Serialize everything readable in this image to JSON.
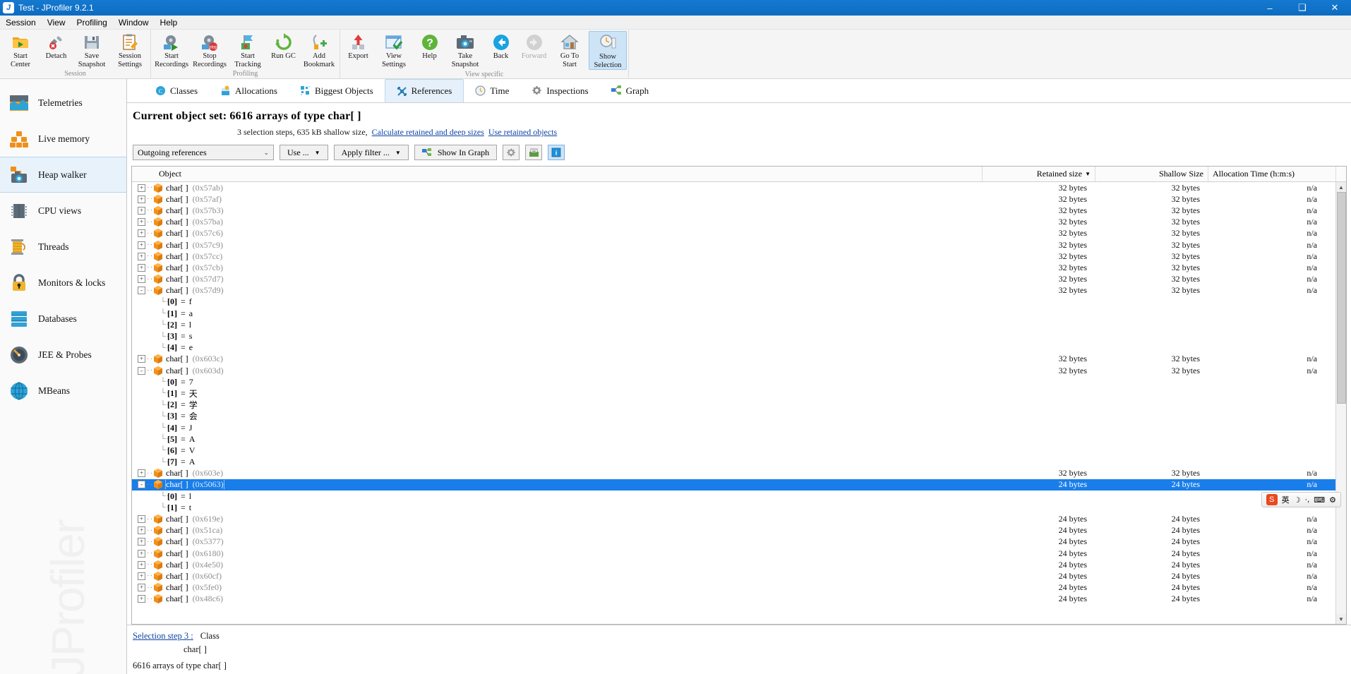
{
  "window": {
    "title": "Test - JProfiler 9.2.1",
    "app_icon": "jprofiler-icon",
    "minimize": "–",
    "maximize": "❑",
    "close": "✕"
  },
  "menubar": [
    {
      "label": "Session"
    },
    {
      "label": "View"
    },
    {
      "label": "Profiling"
    },
    {
      "label": "Window"
    },
    {
      "label": "Help"
    }
  ],
  "toolbar": {
    "groups": [
      {
        "label": "Session",
        "buttons": [
          {
            "caption": "Start\nCenter",
            "icon": "start-center-icon",
            "state": "normal"
          },
          {
            "caption": "Detach",
            "icon": "detach-icon",
            "state": "normal"
          },
          {
            "caption": "Save\nSnapshot",
            "icon": "save-snapshot-icon",
            "state": "normal"
          },
          {
            "caption": "Session\nSettings",
            "icon": "session-settings-icon",
            "state": "normal"
          }
        ]
      },
      {
        "label": "Profiling",
        "buttons": [
          {
            "caption": "Start\nRecordings",
            "icon": "start-recordings-icon",
            "state": "normal"
          },
          {
            "caption": "Stop\nRecordings",
            "icon": "stop-recordings-icon",
            "state": "normal"
          },
          {
            "caption": "Start\nTracking",
            "icon": "start-tracking-icon",
            "state": "normal"
          },
          {
            "caption": "Run GC",
            "icon": "run-gc-icon",
            "state": "normal"
          },
          {
            "caption": "Add\nBookmark",
            "icon": "add-bookmark-icon",
            "state": "normal"
          }
        ]
      },
      {
        "label": "View specific",
        "buttons": [
          {
            "caption": "Export",
            "icon": "export-icon",
            "state": "normal"
          },
          {
            "caption": "View\nSettings",
            "icon": "view-settings-icon",
            "state": "normal"
          },
          {
            "caption": "Help",
            "icon": "help-icon",
            "state": "normal"
          },
          {
            "caption": "Take\nSnapshot",
            "icon": "take-snapshot-icon",
            "state": "normal"
          },
          {
            "caption": "Back",
            "icon": "back-arrow-icon",
            "state": "normal"
          },
          {
            "caption": "Forward",
            "icon": "forward-arrow-icon",
            "state": "disabled"
          },
          {
            "caption": "Go To\nStart",
            "icon": "go-to-start-icon",
            "state": "normal"
          },
          {
            "caption": "Show\nSelection",
            "icon": "show-selection-icon",
            "state": "active"
          }
        ]
      }
    ]
  },
  "sidebar": {
    "items": [
      {
        "label": "Telemetries",
        "icon": "telemetries-icon",
        "active": false
      },
      {
        "label": "Live memory",
        "icon": "live-memory-icon",
        "active": false
      },
      {
        "label": "Heap walker",
        "icon": "heap-walker-icon",
        "active": true
      },
      {
        "label": "CPU views",
        "icon": "cpu-views-icon",
        "active": false
      },
      {
        "label": "Threads",
        "icon": "threads-icon",
        "active": false
      },
      {
        "label": "Monitors & locks",
        "icon": "monitors-locks-icon",
        "active": false
      },
      {
        "label": "Databases",
        "icon": "databases-icon",
        "active": false
      },
      {
        "label": "JEE & Probes",
        "icon": "jee-probes-icon",
        "active": false
      },
      {
        "label": "MBeans",
        "icon": "mbeans-icon",
        "active": false
      }
    ],
    "watermark": "JProfiler"
  },
  "tabs": [
    {
      "label": "Classes",
      "icon": "classes-icon",
      "active": false
    },
    {
      "label": "Allocations",
      "icon": "allocations-icon",
      "active": false
    },
    {
      "label": "Biggest Objects",
      "icon": "biggest-objects-icon",
      "active": false
    },
    {
      "label": "References",
      "icon": "references-icon",
      "active": true
    },
    {
      "label": "Time",
      "icon": "time-icon",
      "active": false
    },
    {
      "label": "Inspections",
      "icon": "inspections-icon",
      "active": false
    },
    {
      "label": "Graph",
      "icon": "graph-icon",
      "active": false
    }
  ],
  "headline": {
    "title": "Current object set: 6616 arrays of type char[ ]",
    "summary": "3 selection steps, 635 kB shallow size,",
    "link_calculate": "Calculate retained and deep sizes",
    "link_retained": "Use retained objects"
  },
  "filterbar": {
    "mode_value": "Outgoing references",
    "mode_arrow": "⌄",
    "use_label": "Use ...",
    "apply_filter_label": "Apply filter ...",
    "dropdown_arrow": "▼",
    "show_in_graph_label": "Show In Graph",
    "gear_icon": "gear-icon",
    "snapshot_icon": "export-view-icon",
    "info_icon": "info-icon"
  },
  "table": {
    "columns": [
      {
        "label": "Object",
        "sorted": false
      },
      {
        "label": "Retained size",
        "sorted": true,
        "sort_arrow": "▼"
      },
      {
        "label": "Shallow Size",
        "sorted": false
      },
      {
        "label": "Allocation Time (h:m:s)",
        "sorted": false
      }
    ],
    "rows": [
      {
        "kind": "obj",
        "toggle": "+",
        "name": "char[ ]",
        "addr": "(0x57ab)",
        "retained": "32 bytes",
        "shallow": "32 bytes",
        "alloc": "n/a",
        "selected": false
      },
      {
        "kind": "obj",
        "toggle": "+",
        "name": "char[ ]",
        "addr": "(0x57af)",
        "retained": "32 bytes",
        "shallow": "32 bytes",
        "alloc": "n/a",
        "selected": false
      },
      {
        "kind": "obj",
        "toggle": "+",
        "name": "char[ ]",
        "addr": "(0x57b3)",
        "retained": "32 bytes",
        "shallow": "32 bytes",
        "alloc": "n/a",
        "selected": false
      },
      {
        "kind": "obj",
        "toggle": "+",
        "name": "char[ ]",
        "addr": "(0x57ba)",
        "retained": "32 bytes",
        "shallow": "32 bytes",
        "alloc": "n/a",
        "selected": false
      },
      {
        "kind": "obj",
        "toggle": "+",
        "name": "char[ ]",
        "addr": "(0x57c6)",
        "retained": "32 bytes",
        "shallow": "32 bytes",
        "alloc": "n/a",
        "selected": false
      },
      {
        "kind": "obj",
        "toggle": "+",
        "name": "char[ ]",
        "addr": "(0x57c9)",
        "retained": "32 bytes",
        "shallow": "32 bytes",
        "alloc": "n/a",
        "selected": false
      },
      {
        "kind": "obj",
        "toggle": "+",
        "name": "char[ ]",
        "addr": "(0x57cc)",
        "retained": "32 bytes",
        "shallow": "32 bytes",
        "alloc": "n/a",
        "selected": false
      },
      {
        "kind": "obj",
        "toggle": "+",
        "name": "char[ ]",
        "addr": "(0x57cb)",
        "retained": "32 bytes",
        "shallow": "32 bytes",
        "alloc": "n/a",
        "selected": false
      },
      {
        "kind": "obj",
        "toggle": "+",
        "name": "char[ ]",
        "addr": "(0x57d7)",
        "retained": "32 bytes",
        "shallow": "32 bytes",
        "alloc": "n/a",
        "selected": false
      },
      {
        "kind": "obj",
        "toggle": "-",
        "name": "char[ ]",
        "addr": "(0x57d9)",
        "retained": "32 bytes",
        "shallow": "32 bytes",
        "alloc": "n/a",
        "selected": false
      },
      {
        "kind": "elem",
        "index": "[0]",
        "value": "f"
      },
      {
        "kind": "elem",
        "index": "[1]",
        "value": "a"
      },
      {
        "kind": "elem",
        "index": "[2]",
        "value": "l"
      },
      {
        "kind": "elem",
        "index": "[3]",
        "value": "s"
      },
      {
        "kind": "elem",
        "index": "[4]",
        "value": "e"
      },
      {
        "kind": "obj",
        "toggle": "+",
        "name": "char[ ]",
        "addr": "(0x603c)",
        "retained": "32 bytes",
        "shallow": "32 bytes",
        "alloc": "n/a",
        "selected": false
      },
      {
        "kind": "obj",
        "toggle": "-",
        "name": "char[ ]",
        "addr": "(0x603d)",
        "retained": "32 bytes",
        "shallow": "32 bytes",
        "alloc": "n/a",
        "selected": false
      },
      {
        "kind": "elem",
        "index": "[0]",
        "value": "7"
      },
      {
        "kind": "elem",
        "index": "[1]",
        "value": "天"
      },
      {
        "kind": "elem",
        "index": "[2]",
        "value": "学"
      },
      {
        "kind": "elem",
        "index": "[3]",
        "value": "会"
      },
      {
        "kind": "elem",
        "index": "[4]",
        "value": "J"
      },
      {
        "kind": "elem",
        "index": "[5]",
        "value": "A"
      },
      {
        "kind": "elem",
        "index": "[6]",
        "value": "V"
      },
      {
        "kind": "elem",
        "index": "[7]",
        "value": "A"
      },
      {
        "kind": "obj",
        "toggle": "+",
        "name": "char[ ]",
        "addr": "(0x603e)",
        "retained": "32 bytes",
        "shallow": "32 bytes",
        "alloc": "n/a",
        "selected": false
      },
      {
        "kind": "obj",
        "toggle": "-",
        "name": "char[ ]",
        "addr": "(0x5063)",
        "retained": "24 bytes",
        "shallow": "24 bytes",
        "alloc": "n/a",
        "selected": true
      },
      {
        "kind": "elem",
        "index": "[0]",
        "value": "l"
      },
      {
        "kind": "elem",
        "index": "[1]",
        "value": "t"
      },
      {
        "kind": "obj",
        "toggle": "+",
        "name": "char[ ]",
        "addr": "(0x619e)",
        "retained": "24 bytes",
        "shallow": "24 bytes",
        "alloc": "n/a",
        "selected": false
      },
      {
        "kind": "obj",
        "toggle": "+",
        "name": "char[ ]",
        "addr": "(0x51ca)",
        "retained": "24 bytes",
        "shallow": "24 bytes",
        "alloc": "n/a",
        "selected": false
      },
      {
        "kind": "obj",
        "toggle": "+",
        "name": "char[ ]",
        "addr": "(0x5377)",
        "retained": "24 bytes",
        "shallow": "24 bytes",
        "alloc": "n/a",
        "selected": false
      },
      {
        "kind": "obj",
        "toggle": "+",
        "name": "char[ ]",
        "addr": "(0x6180)",
        "retained": "24 bytes",
        "shallow": "24 bytes",
        "alloc": "n/a",
        "selected": false
      },
      {
        "kind": "obj",
        "toggle": "+",
        "name": "char[ ]",
        "addr": "(0x4e50)",
        "retained": "24 bytes",
        "shallow": "24 bytes",
        "alloc": "n/a",
        "selected": false
      },
      {
        "kind": "obj",
        "toggle": "+",
        "name": "char[ ]",
        "addr": "(0x60cf)",
        "retained": "24 bytes",
        "shallow": "24 bytes",
        "alloc": "n/a",
        "selected": false
      },
      {
        "kind": "obj",
        "toggle": "+",
        "name": "char[ ]",
        "addr": "(0x5fe0)",
        "retained": "24 bytes",
        "shallow": "24 bytes",
        "alloc": "n/a",
        "selected": false
      },
      {
        "kind": "obj",
        "toggle": "+",
        "name": "char[ ]",
        "addr": "(0x48c6)",
        "retained": "24 bytes",
        "shallow": "24 bytes",
        "alloc": "n/a",
        "selected": false
      }
    ],
    "scroll_up": "▲",
    "scroll_down": "▼"
  },
  "footer": {
    "step_link": "Selection step 3 :",
    "step_kind": "Class",
    "step_detail": "char[ ]",
    "result": "6616 arrays of type char[ ]"
  },
  "ime": {
    "lang": "英",
    "moon": "☽",
    "dot": "·,",
    "keyboard": "⌨",
    "tools": "⚙"
  }
}
